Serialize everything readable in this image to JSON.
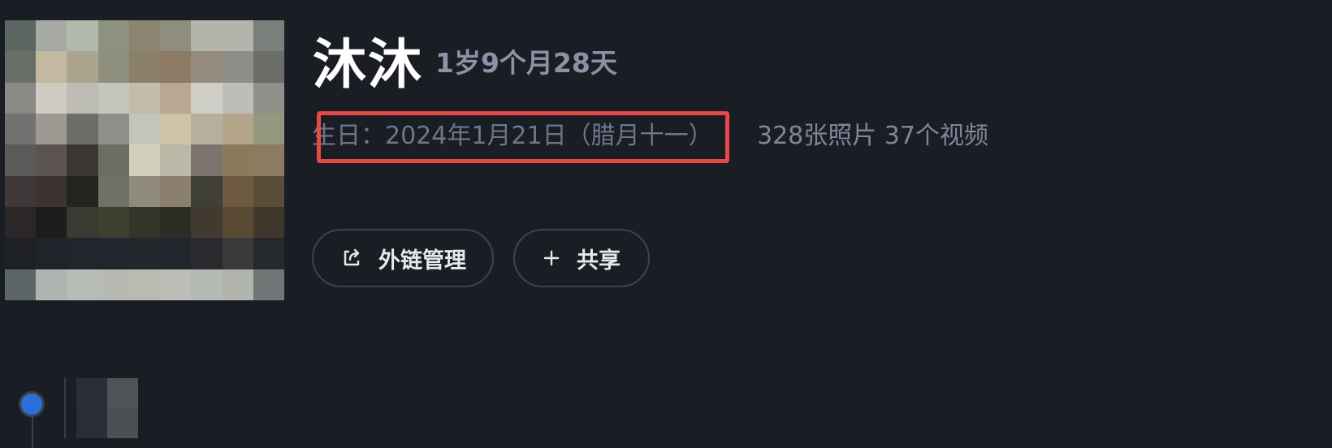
{
  "profile": {
    "name": "沐沐",
    "age": "1岁9个月28天",
    "birthday": "生日：2024年1月21日（腊月十一）",
    "counts": "328张照片 37个视频"
  },
  "actions": {
    "external_link_label": "外链管理",
    "share_label": "共享"
  },
  "icons": {
    "external_link": "external-link-icon",
    "share": "plus-icon"
  },
  "colors": {
    "background": "#1b1d24",
    "highlight": "#e8474c",
    "timeline_dot": "#2b6fd9"
  }
}
